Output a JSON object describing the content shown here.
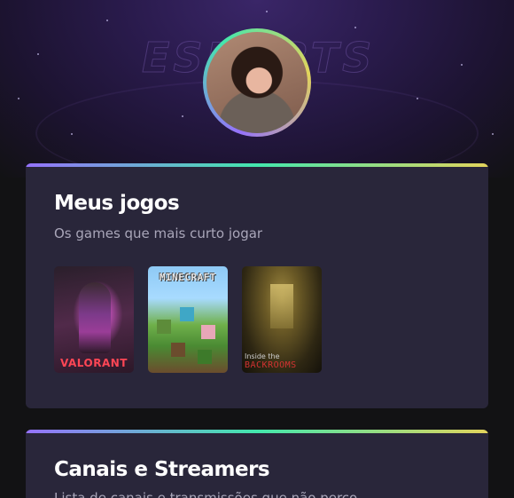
{
  "profile": {
    "avatar_icon": "profile-photo"
  },
  "games_section": {
    "title": "Meus jogos",
    "subtitle": "Os games que mais curto jogar",
    "games": [
      {
        "logo_text": "VALORANT"
      },
      {
        "logo_text": "MINECRAFT"
      },
      {
        "logo_text_line1": "Inside the",
        "logo_text_line2": "BACKROOMS"
      }
    ]
  },
  "channels_section": {
    "title": "Canais e Streamers",
    "subtitle": "Lista de canais e transmissões que não perco"
  },
  "colors": {
    "accent_gradient": [
      "#9572fc",
      "#43e7ad",
      "#e2d45c"
    ],
    "card_bg": "#29263a",
    "page_bg": "#121214"
  }
}
